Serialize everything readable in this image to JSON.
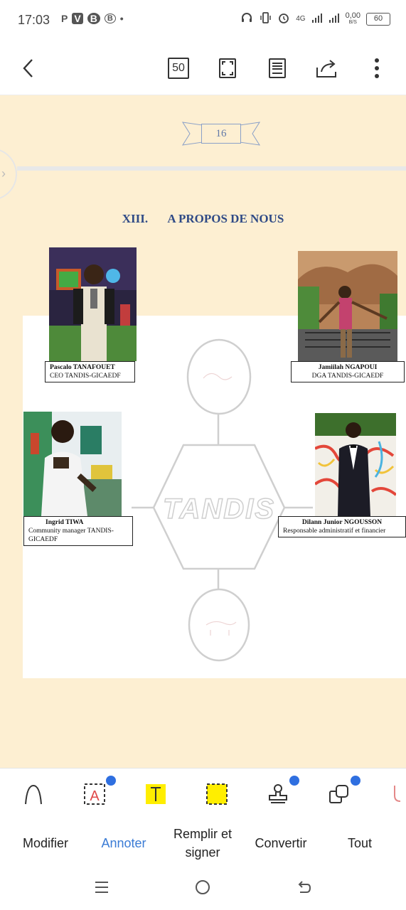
{
  "status_bar": {
    "time": "17:03",
    "left_icons": [
      "P",
      "V",
      "B",
      "B",
      "•"
    ],
    "network": "4G",
    "speed": "0,00",
    "speed_unit": "B/S",
    "battery": "60"
  },
  "toolbar": {
    "back_icon": "chevron-left-icon",
    "page_count": "50",
    "icons": [
      "fullscreen-icon",
      "reader-mode-icon",
      "share-icon",
      "more-vert-icon"
    ]
  },
  "document": {
    "page_number": "16",
    "section_number": "XIII.",
    "section_title": "A PROPOS DE NOUS",
    "watermark": "TANDIS",
    "members": [
      {
        "name": "Pascalo TANAFOUET",
        "role": "CEO TANDIS-GICAEDF"
      },
      {
        "name": "Jamiilah NGAPOUI",
        "role": "DGA TANDIS-GICAEDF"
      },
      {
        "name": "Ingrid TIWA",
        "role": "Community manager TANDIS-GICAEDF"
      },
      {
        "name": "Dilann Junior NGOUSSON",
        "role": "Responsable administratif et financier"
      }
    ]
  },
  "tools": [
    "ink-icon",
    "text-box-icon",
    "text-highlight-icon",
    "area-highlight-icon",
    "stamp-icon",
    "shapes-icon",
    "underline-icon"
  ],
  "tabs": [
    {
      "label": "Modifier"
    },
    {
      "label": "Annoter"
    },
    {
      "label": "Remplir et signer"
    },
    {
      "label": "Convertir"
    },
    {
      "label": "Tout"
    }
  ],
  "colors": {
    "page_bg": "#fdefd2",
    "accent": "#3a7bd5",
    "title": "#2f4a86",
    "highlight": "#ffee00"
  }
}
